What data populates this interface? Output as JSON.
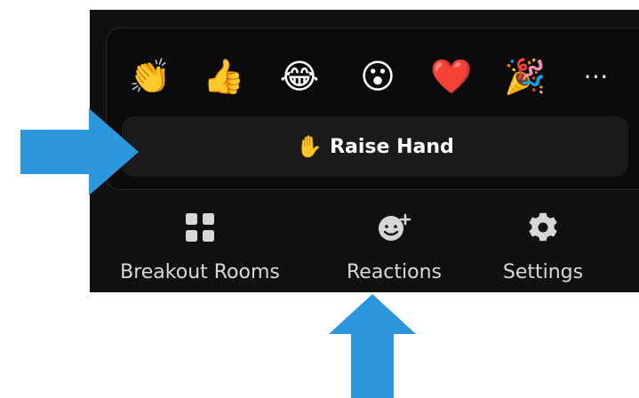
{
  "reactions_popup": {
    "emojis": [
      {
        "name": "clap-emoji",
        "glyph": "👏"
      },
      {
        "name": "thumbs-up-emoji",
        "glyph": "👍"
      },
      {
        "name": "laughing-emoji",
        "glyph": "😂"
      },
      {
        "name": "surprised-emoji",
        "glyph": "😮"
      },
      {
        "name": "heart-emoji",
        "glyph": "❤️"
      },
      {
        "name": "party-emoji",
        "glyph": "🎉"
      },
      {
        "name": "more-options",
        "glyph": "⋯"
      }
    ],
    "raise_hand": {
      "icon": "✋",
      "label": "Raise Hand"
    }
  },
  "toolbar": {
    "items": [
      {
        "label": "Breakout Rooms",
        "icon": "grid-icon"
      },
      {
        "label": "Reactions",
        "icon": "smile-plus-icon"
      },
      {
        "label": "Settings",
        "icon": "gear-icon"
      }
    ]
  },
  "colors": {
    "panel_bg": "#111111",
    "popup_bg": "#0b0b0b",
    "button_bg": "#1b1b1b",
    "text_primary": "#ffffff",
    "text_secondary": "#d9d9d9",
    "arrow_blue": "#2c97dd"
  }
}
